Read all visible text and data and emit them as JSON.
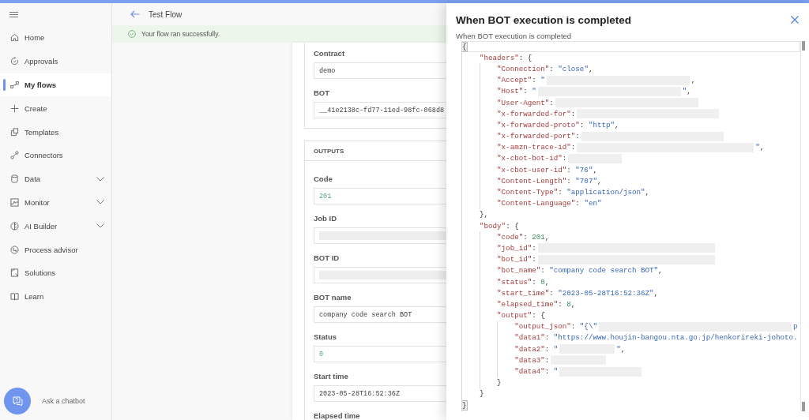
{
  "sidebar": {
    "items": [
      {
        "label": "Home",
        "kind": "link",
        "selected": false
      },
      {
        "label": "Approvals",
        "kind": "link",
        "selected": false
      },
      {
        "label": "My flows",
        "kind": "link",
        "selected": true
      },
      {
        "label": "Create",
        "kind": "link",
        "selected": false
      },
      {
        "label": "Templates",
        "kind": "link",
        "selected": false
      },
      {
        "label": "Connectors",
        "kind": "link",
        "selected": false
      },
      {
        "label": "Data",
        "kind": "group",
        "selected": false
      },
      {
        "label": "Monitor",
        "kind": "group",
        "selected": false
      },
      {
        "label": "AI Builder",
        "kind": "group",
        "selected": false
      },
      {
        "label": "Process advisor",
        "kind": "link",
        "selected": false
      },
      {
        "label": "Solutions",
        "kind": "link",
        "selected": false
      },
      {
        "label": "Learn",
        "kind": "link",
        "selected": false
      }
    ],
    "chatbot": {
      "label": "Ask a chatbot"
    }
  },
  "header": {
    "title": "Test Flow"
  },
  "banner": {
    "message": "Your flow ran successfully."
  },
  "inputs": {
    "fields": [
      {
        "label": "Contract",
        "kind": "text",
        "value": "demo"
      },
      {
        "label": "BOT",
        "kind": "text",
        "value": "__41e2138c-fd77-11ed-98fc-068d8"
      }
    ]
  },
  "outputs": {
    "title": "OUTPUTS",
    "fields": [
      {
        "label": "Code",
        "kind": "number",
        "value": "201"
      },
      {
        "label": "Job ID",
        "kind": "redacted"
      },
      {
        "label": "BOT ID",
        "kind": "redacted"
      },
      {
        "label": "BOT name",
        "kind": "text",
        "value": "company code search BOT"
      },
      {
        "label": "Status",
        "kind": "number",
        "value": "0"
      },
      {
        "label": "Start time",
        "kind": "text",
        "value": "2023-05-28T16:52:36Z"
      },
      {
        "label": "Elapsed time"
      }
    ]
  },
  "panel": {
    "title": "When BOT execution is completed",
    "subtitle": "When BOT execution is completed",
    "editor": {
      "lines": [
        {
          "active": true,
          "parts": [
            {
              "kind": "code",
              "tokens": [
                {
                  "kind": "match",
                  "text": "{"
                }
              ]
            }
          ]
        },
        {
          "active": false,
          "parts": [
            {
              "kind": "code",
              "tokens": [
                {
                  "kind": "key",
                  "text": "    \"headers\""
                },
                {
                  "kind": "punct",
                  "text": ": {"
                }
              ]
            }
          ]
        },
        {
          "active": false,
          "parts": [
            {
              "kind": "code",
              "tokens": [
                {
                  "kind": "key",
                  "text": "        \"Connection\""
                },
                {
                  "kind": "punct",
                  "text": ": "
                },
                {
                  "kind": "string",
                  "text": "\"close\""
                },
                {
                  "kind": "punct",
                  "text": ","
                }
              ]
            }
          ]
        },
        {
          "active": false,
          "parts": [
            {
              "kind": "code",
              "tokens": [
                {
                  "kind": "key",
                  "text": "        \"Accept\""
                },
                {
                  "kind": "punct",
                  "text": ": "
                },
                {
                  "kind": "string",
                  "text": "\""
                }
              ]
            },
            {
              "kind": "redacted"
            },
            {
              "kind": "code",
              "tokens": [
                {
                  "kind": "punct",
                  "text": ","
                }
              ]
            }
          ]
        },
        {
          "active": false,
          "parts": [
            {
              "kind": "code",
              "tokens": [
                {
                  "kind": "key",
                  "text": "        \"Host\""
                },
                {
                  "kind": "punct",
                  "text": ": "
                },
                {
                  "kind": "string",
                  "text": "\""
                }
              ]
            },
            {
              "kind": "redacted"
            },
            {
              "kind": "code",
              "tokens": [
                {
                  "kind": "string",
                  "text": "\""
                },
                {
                  "kind": "punct",
                  "text": ","
                }
              ]
            }
          ]
        },
        {
          "active": false,
          "parts": [
            {
              "kind": "code",
              "tokens": [
                {
                  "kind": "key",
                  "text": "        \"User-Agent\""
                },
                {
                  "kind": "punct",
                  "text": ":"
                }
              ]
            },
            {
              "kind": "redacted"
            }
          ]
        },
        {
          "active": false,
          "parts": [
            {
              "kind": "code",
              "tokens": [
                {
                  "kind": "key",
                  "text": "        \"x-forwarded-for\""
                },
                {
                  "kind": "punct",
                  "text": ":"
                }
              ]
            },
            {
              "kind": "redacted"
            }
          ]
        },
        {
          "active": false,
          "parts": [
            {
              "kind": "code",
              "tokens": [
                {
                  "kind": "key",
                  "text": "        \"x-forwarded-proto\""
                },
                {
                  "kind": "punct",
                  "text": ": "
                },
                {
                  "kind": "string",
                  "text": "\"http\""
                },
                {
                  "kind": "punct",
                  "text": ","
                }
              ]
            }
          ]
        },
        {
          "active": false,
          "parts": [
            {
              "kind": "code",
              "tokens": [
                {
                  "kind": "key",
                  "text": "        \"x-forwarded-port\""
                },
                {
                  "kind": "punct",
                  "text": ":"
                }
              ]
            },
            {
              "kind": "redacted"
            }
          ]
        },
        {
          "active": false,
          "parts": [
            {
              "kind": "code",
              "tokens": [
                {
                  "kind": "key",
                  "text": "        \"x-amzn-trace-id\""
                },
                {
                  "kind": "punct",
                  "text": ":"
                }
              ]
            },
            {
              "kind": "redacted"
            },
            {
              "kind": "code",
              "tokens": [
                {
                  "kind": "string",
                  "text": "\""
                },
                {
                  "kind": "punct",
                  "text": ","
                }
              ]
            }
          ]
        },
        {
          "active": false,
          "parts": [
            {
              "kind": "code",
              "tokens": [
                {
                  "kind": "key",
                  "text": "        \"x-cbot-bot-id\""
                },
                {
                  "kind": "punct",
                  "text": ":"
                }
              ]
            },
            {
              "kind": "redacted"
            }
          ]
        },
        {
          "active": false,
          "parts": [
            {
              "kind": "code",
              "tokens": [
                {
                  "kind": "key",
                  "text": "        \"x-cbot-user-id\""
                },
                {
                  "kind": "punct",
                  "text": ": "
                },
                {
                  "kind": "string",
                  "text": "\"76\""
                },
                {
                  "kind": "punct",
                  "text": ","
                }
              ]
            }
          ]
        },
        {
          "active": false,
          "parts": [
            {
              "kind": "code",
              "tokens": [
                {
                  "kind": "key",
                  "text": "        \"Content-Length\""
                },
                {
                  "kind": "punct",
                  "text": ": "
                },
                {
                  "kind": "string",
                  "text": "\"707\""
                },
                {
                  "kind": "punct",
                  "text": ","
                }
              ]
            }
          ]
        },
        {
          "active": false,
          "parts": [
            {
              "kind": "code",
              "tokens": [
                {
                  "kind": "key",
                  "text": "        \"Content-Type\""
                },
                {
                  "kind": "punct",
                  "text": ": "
                },
                {
                  "kind": "string",
                  "text": "\"application/json\""
                },
                {
                  "kind": "punct",
                  "text": ","
                }
              ]
            }
          ]
        },
        {
          "active": false,
          "parts": [
            {
              "kind": "code",
              "tokens": [
                {
                  "kind": "key",
                  "text": "        \"Content-Language\""
                },
                {
                  "kind": "punct",
                  "text": ": "
                },
                {
                  "kind": "string",
                  "text": "\"en\""
                }
              ]
            }
          ]
        },
        {
          "active": false,
          "parts": [
            {
              "kind": "code",
              "tokens": [
                {
                  "kind": "punct",
                  "text": "    },"
                }
              ]
            }
          ]
        },
        {
          "active": false,
          "parts": [
            {
              "kind": "code",
              "tokens": [
                {
                  "kind": "key",
                  "text": "    \"body\""
                },
                {
                  "kind": "punct",
                  "text": ": {"
                }
              ]
            }
          ]
        },
        {
          "active": false,
          "parts": [
            {
              "kind": "code",
              "tokens": [
                {
                  "kind": "key",
                  "text": "        \"code\""
                },
                {
                  "kind": "punct",
                  "text": ": "
                },
                {
                  "kind": "number",
                  "text": "201"
                },
                {
                  "kind": "punct",
                  "text": ","
                }
              ]
            }
          ]
        },
        {
          "active": false,
          "parts": [
            {
              "kind": "code",
              "tokens": [
                {
                  "kind": "key",
                  "text": "        \"job_id\""
                },
                {
                  "kind": "punct",
                  "text": ":"
                }
              ]
            },
            {
              "kind": "redacted"
            }
          ]
        },
        {
          "active": false,
          "parts": [
            {
              "kind": "code",
              "tokens": [
                {
                  "kind": "key",
                  "text": "        \"bot_id\""
                },
                {
                  "kind": "punct",
                  "text": ":"
                }
              ]
            },
            {
              "kind": "redacted"
            }
          ]
        },
        {
          "active": false,
          "parts": [
            {
              "kind": "code",
              "tokens": [
                {
                  "kind": "key",
                  "text": "        \"bot_name\""
                },
                {
                  "kind": "punct",
                  "text": ": "
                },
                {
                  "kind": "string",
                  "text": "\"company code search BOT\""
                },
                {
                  "kind": "punct",
                  "text": ","
                }
              ]
            }
          ]
        },
        {
          "active": false,
          "parts": [
            {
              "kind": "code",
              "tokens": [
                {
                  "kind": "key",
                  "text": "        \"status\""
                },
                {
                  "kind": "punct",
                  "text": ": "
                },
                {
                  "kind": "number",
                  "text": "0"
                },
                {
                  "kind": "punct",
                  "text": ","
                }
              ]
            }
          ]
        },
        {
          "active": false,
          "parts": [
            {
              "kind": "code",
              "tokens": [
                {
                  "kind": "key",
                  "text": "        \"start_time\""
                },
                {
                  "kind": "punct",
                  "text": ": "
                },
                {
                  "kind": "string",
                  "text": "\"2023-05-28T16:52:36Z\""
                },
                {
                  "kind": "punct",
                  "text": ","
                }
              ]
            }
          ]
        },
        {
          "active": false,
          "parts": [
            {
              "kind": "code",
              "tokens": [
                {
                  "kind": "key",
                  "text": "        \"elapsed_time\""
                },
                {
                  "kind": "punct",
                  "text": ": "
                },
                {
                  "kind": "number",
                  "text": "8"
                },
                {
                  "kind": "punct",
                  "text": ","
                }
              ]
            }
          ]
        },
        {
          "active": false,
          "parts": [
            {
              "kind": "code",
              "tokens": [
                {
                  "kind": "key",
                  "text": "        \"output\""
                },
                {
                  "kind": "punct",
                  "text": ": {"
                }
              ]
            }
          ]
        },
        {
          "active": false,
          "parts": [
            {
              "kind": "code",
              "tokens": [
                {
                  "kind": "key",
                  "text": "            \"output_json\""
                },
                {
                  "kind": "punct",
                  "text": ": "
                },
                {
                  "kind": "string",
                  "text": "\"{\\\""
                }
              ]
            },
            {
              "kind": "redacted"
            },
            {
              "kind": "code",
              "tokens": [
                {
                  "kind": "string",
                  "text": "p"
                }
              ]
            }
          ]
        },
        {
          "active": false,
          "parts": [
            {
              "kind": "code",
              "tokens": [
                {
                  "kind": "key",
                  "text": "            \"data1\""
                },
                {
                  "kind": "punct",
                  "text": ": "
                },
                {
                  "kind": "string",
                  "text": "\"https://www.houjin-bangou.nta.go.jp/henkorireki-johoto."
                }
              ]
            }
          ]
        },
        {
          "active": false,
          "parts": [
            {
              "kind": "code",
              "tokens": [
                {
                  "kind": "key",
                  "text": "            \"data2\""
                },
                {
                  "kind": "punct",
                  "text": ": "
                },
                {
                  "kind": "string",
                  "text": "\""
                }
              ]
            },
            {
              "kind": "redacted"
            },
            {
              "kind": "code",
              "tokens": [
                {
                  "kind": "string",
                  "text": "\""
                },
                {
                  "kind": "punct",
                  "text": ","
                }
              ]
            }
          ]
        },
        {
          "active": false,
          "parts": [
            {
              "kind": "code",
              "tokens": [
                {
                  "kind": "key",
                  "text": "            \"data3\""
                },
                {
                  "kind": "punct",
                  "text": ":"
                }
              ]
            },
            {
              "kind": "redacted"
            }
          ]
        },
        {
          "active": false,
          "parts": [
            {
              "kind": "code",
              "tokens": [
                {
                  "kind": "key",
                  "text": "            \"data4\""
                },
                {
                  "kind": "punct",
                  "text": ": "
                },
                {
                  "kind": "string",
                  "text": "\""
                }
              ]
            },
            {
              "kind": "redacted"
            }
          ]
        },
        {
          "active": false,
          "parts": [
            {
              "kind": "code",
              "tokens": [
                {
                  "kind": "punct",
                  "text": "        }"
                }
              ]
            }
          ]
        },
        {
          "active": false,
          "parts": [
            {
              "kind": "code",
              "tokens": [
                {
                  "kind": "punct",
                  "text": "    }"
                }
              ]
            }
          ]
        },
        {
          "active": false,
          "parts": [
            {
              "kind": "code",
              "tokens": [
                {
                  "kind": "match",
                  "text": "}"
                }
              ]
            }
          ]
        }
      ]
    }
  }
}
